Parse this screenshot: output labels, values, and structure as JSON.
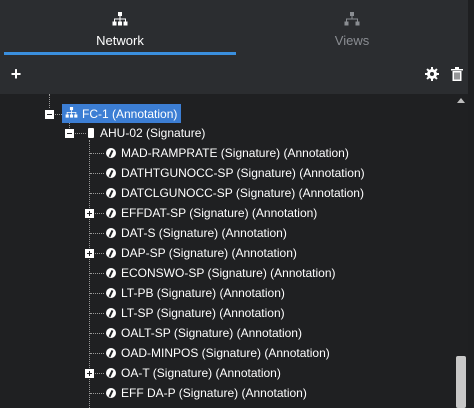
{
  "tabs": [
    {
      "label": "Network",
      "icon": "network-icon",
      "active": true
    },
    {
      "label": "Views",
      "icon": "views-icon",
      "active": false
    }
  ],
  "toolbar": {
    "add_icon": "plus-icon",
    "settings_icon": "gear-icon",
    "delete_icon": "trash-icon"
  },
  "tree": {
    "root": {
      "label": "FC-1 (Annotation)",
      "icon": "network-icon",
      "selected": true
    },
    "device": {
      "label": "AHU-02 (Signature)",
      "icon": "device-icon"
    },
    "signals": [
      {
        "label": "MAD-RAMPRATE (Signature) (Annotation)",
        "expandable": false
      },
      {
        "label": "DATHTGUNOCC-SP (Signature) (Annotation)",
        "expandable": false
      },
      {
        "label": "DATCLGUNOCC-SP (Signature) (Annotation)",
        "expandable": false
      },
      {
        "label": "EFFDAT-SP (Signature) (Annotation)",
        "expandable": true
      },
      {
        "label": "DAT-S (Signature) (Annotation)",
        "expandable": false
      },
      {
        "label": "DAP-SP (Signature) (Annotation)",
        "expandable": true
      },
      {
        "label": "ECONSWO-SP (Signature) (Annotation)",
        "expandable": false
      },
      {
        "label": "LT-PB (Signature) (Annotation)",
        "expandable": false
      },
      {
        "label": "LT-SP (Signature) (Annotation)",
        "expandable": false
      },
      {
        "label": "OALT-SP (Signature) (Annotation)",
        "expandable": false
      },
      {
        "label": "OAD-MINPOS (Signature) (Annotation)",
        "expandable": false
      },
      {
        "label": "OA-T (Signature) (Annotation)",
        "expandable": true
      },
      {
        "label": "EFF DA-P (Signature) (Annotation)",
        "expandable": false
      }
    ]
  },
  "colors": {
    "accent": "#3a8fde",
    "selection": "#3c7ed4",
    "panel": "#2b2d30",
    "tree_bg": "#1f2022"
  }
}
